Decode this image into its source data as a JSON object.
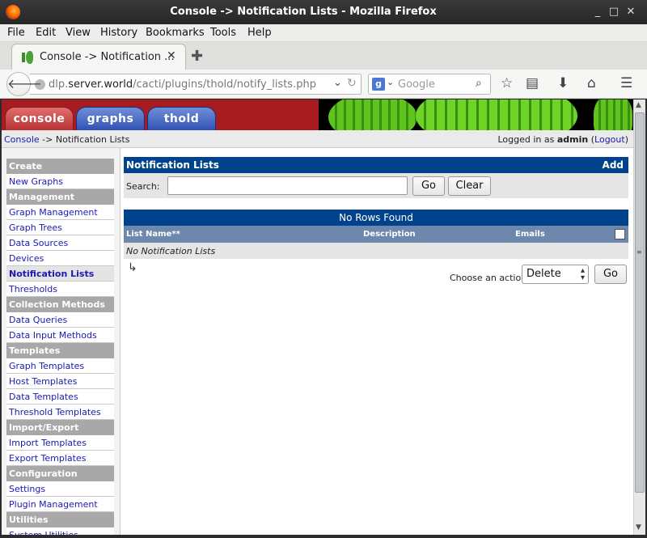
{
  "window": {
    "title": "Console -> Notification Lists - Mozilla Firefox",
    "controls": [
      "_",
      "□",
      "✕"
    ]
  },
  "menu": [
    "File",
    "Edit",
    "View",
    "History",
    "Bookmarks",
    "Tools",
    "Help"
  ],
  "tab": {
    "label": "Console -> Notification ...",
    "close": "✕",
    "new_tab": "✚"
  },
  "navbar": {
    "url_host_prefix": "dlp.",
    "url_host": "server.world",
    "url_path": "/cacti/plugins/thold/notify_lists.php",
    "search_placeholder": "Google",
    "search_engine": "g"
  },
  "cacti_tabs": [
    "console",
    "graphs",
    "thold"
  ],
  "breadcrumb": {
    "root": "Console",
    "sep": " -> ",
    "current": "Notification Lists"
  },
  "login": {
    "prefix": "Logged in as ",
    "user": "admin",
    "logout": "Logout"
  },
  "sidebar": [
    {
      "type": "head",
      "label": "Create"
    },
    {
      "type": "item",
      "label": "New Graphs"
    },
    {
      "type": "head",
      "label": "Management"
    },
    {
      "type": "item",
      "label": "Graph Management"
    },
    {
      "type": "item",
      "label": "Graph Trees"
    },
    {
      "type": "item",
      "label": "Data Sources"
    },
    {
      "type": "item",
      "label": "Devices"
    },
    {
      "type": "item",
      "label": "Notification Lists",
      "active": true
    },
    {
      "type": "item",
      "label": "Thresholds"
    },
    {
      "type": "head",
      "label": "Collection Methods"
    },
    {
      "type": "item",
      "label": "Data Queries"
    },
    {
      "type": "item",
      "label": "Data Input Methods"
    },
    {
      "type": "head",
      "label": "Templates"
    },
    {
      "type": "item",
      "label": "Graph Templates"
    },
    {
      "type": "item",
      "label": "Host Templates"
    },
    {
      "type": "item",
      "label": "Data Templates"
    },
    {
      "type": "item",
      "label": "Threshold Templates"
    },
    {
      "type": "head",
      "label": "Import/Export"
    },
    {
      "type": "item",
      "label": "Import Templates"
    },
    {
      "type": "item",
      "label": "Export Templates"
    },
    {
      "type": "head",
      "label": "Configuration"
    },
    {
      "type": "item",
      "label": "Settings"
    },
    {
      "type": "item",
      "label": "Plugin Management"
    },
    {
      "type": "head",
      "label": "Utilities"
    },
    {
      "type": "item",
      "label": "System Utilities"
    }
  ],
  "main": {
    "panel_title": "Notification Lists",
    "add_label": "Add",
    "search_label": "Search:",
    "search_value": "",
    "go_label": "Go",
    "clear_label": "Clear",
    "results_banner": "No Rows Found",
    "columns": [
      "List Name**",
      "Description",
      "Emails"
    ],
    "empty_text": "No Notification Lists",
    "choose_label": "Choose an action:",
    "action_selected": "Delete",
    "action_go": "Go"
  }
}
